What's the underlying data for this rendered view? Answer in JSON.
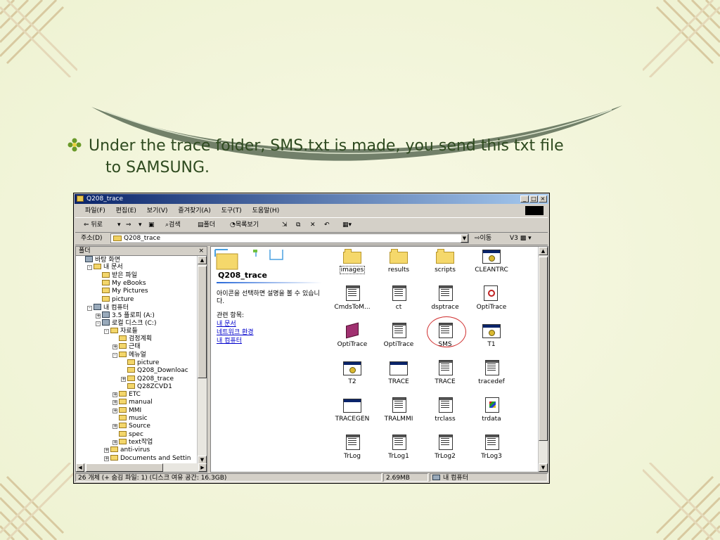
{
  "slide": {
    "bullet_text_line1": "Under the trace folder, SMS.txt is made, you send this txt file",
    "bullet_text_line2": "to SAMSUNG."
  },
  "window": {
    "title": "Q208_trace",
    "title_buttons": [
      "_",
      "□",
      "×"
    ],
    "menu": [
      "파일(F)",
      "편집(E)",
      "보기(V)",
      "즐겨찾기(A)",
      "도구(T)",
      "도움말(H)"
    ],
    "toolbar": {
      "back": "⇐ 뒤로",
      "forward": "⇒",
      "search": "검색",
      "folders": "폴더",
      "history": "목록보기"
    },
    "address": {
      "label": "주소(D)",
      "value": "Q208_trace",
      "go": "이동",
      "v3": "V3"
    }
  },
  "folder_pane": {
    "title": "폴더",
    "close": "×",
    "tree": [
      {
        "label": "바탕 화면",
        "indent": 0,
        "type": "pc",
        "expander": ""
      },
      {
        "label": "내 문서",
        "indent": 1,
        "type": "folder",
        "expander": "-"
      },
      {
        "label": "받은 파일",
        "indent": 2,
        "type": "folder",
        "expander": ""
      },
      {
        "label": "My eBooks",
        "indent": 2,
        "type": "folder",
        "expander": ""
      },
      {
        "label": "My Pictures",
        "indent": 2,
        "type": "folder",
        "expander": ""
      },
      {
        "label": "picture",
        "indent": 2,
        "type": "folder",
        "expander": ""
      },
      {
        "label": "내 컴퓨터",
        "indent": 1,
        "type": "pc",
        "expander": "-"
      },
      {
        "label": "3.5 플로피 (A:)",
        "indent": 2,
        "type": "pc",
        "expander": "+"
      },
      {
        "label": "로컬 디스크 (C:)",
        "indent": 2,
        "type": "pc",
        "expander": "-"
      },
      {
        "label": "자료들",
        "indent": 3,
        "type": "folder",
        "expander": "-"
      },
      {
        "label": "검정계획",
        "indent": 4,
        "type": "folder",
        "expander": ""
      },
      {
        "label": "근태",
        "indent": 4,
        "type": "folder",
        "expander": "+"
      },
      {
        "label": "메뉴얼",
        "indent": 4,
        "type": "folder",
        "expander": "-"
      },
      {
        "label": "picture",
        "indent": 5,
        "type": "folder",
        "expander": ""
      },
      {
        "label": "Q208_Downloac",
        "indent": 5,
        "type": "folder",
        "expander": ""
      },
      {
        "label": "Q208_trace",
        "indent": 5,
        "type": "folder",
        "expander": "+"
      },
      {
        "label": "Q28ZCVD1",
        "indent": 5,
        "type": "folder",
        "expander": ""
      },
      {
        "label": "ETC",
        "indent": 4,
        "type": "folder",
        "expander": "+"
      },
      {
        "label": "manual",
        "indent": 4,
        "type": "folder",
        "expander": "+"
      },
      {
        "label": "MMI",
        "indent": 4,
        "type": "folder",
        "expander": "+"
      },
      {
        "label": "music",
        "indent": 4,
        "type": "folder",
        "expander": ""
      },
      {
        "label": "Source",
        "indent": 4,
        "type": "folder",
        "expander": "+"
      },
      {
        "label": "spec",
        "indent": 4,
        "type": "folder",
        "expander": ""
      },
      {
        "label": "text작업",
        "indent": 4,
        "type": "folder",
        "expander": "+"
      },
      {
        "label": "anti-virus",
        "indent": 3,
        "type": "folder",
        "expander": "+"
      },
      {
        "label": "Documents and Settin",
        "indent": 3,
        "type": "folder",
        "expander": "+"
      }
    ]
  },
  "web_view": {
    "folder_title": "Q208_trace",
    "description": "아이콘을 선택하면 설명을 볼 수 있습니다.",
    "related_label": "관련 항목:",
    "links": [
      "내 문서",
      "네트워크 환경",
      "내 컴퓨터"
    ]
  },
  "files": [
    {
      "name": "images",
      "kind": "folder",
      "selected": true
    },
    {
      "name": "results",
      "kind": "folder"
    },
    {
      "name": "scripts",
      "kind": "folder"
    },
    {
      "name": "CLEANTRC",
      "kind": "exe"
    },
    {
      "name": "CmdsToM...",
      "kind": "txt"
    },
    {
      "name": "ct",
      "kind": "txt"
    },
    {
      "name": "dsptrace",
      "kind": "txt"
    },
    {
      "name": "OptiTrace",
      "kind": "mag"
    },
    {
      "name": "OptiTrace",
      "kind": "book"
    },
    {
      "name": "OptiTrace",
      "kind": "txt"
    },
    {
      "name": "SMS",
      "kind": "txt",
      "highlighted": true
    },
    {
      "name": "T1",
      "kind": "exe"
    },
    {
      "name": "T2",
      "kind": "exe"
    },
    {
      "name": "TRACE",
      "kind": "win"
    },
    {
      "name": "TRACE",
      "kind": "txt"
    },
    {
      "name": "tracedef",
      "kind": "txt"
    },
    {
      "name": "TRACEGEN",
      "kind": "win"
    },
    {
      "name": "TRALMMI",
      "kind": "txt"
    },
    {
      "name": "trclass",
      "kind": "txt"
    },
    {
      "name": "trdata",
      "kind": "wrt"
    },
    {
      "name": "TrLog",
      "kind": "txt"
    },
    {
      "name": "TrLog1",
      "kind": "txt"
    },
    {
      "name": "TrLog2",
      "kind": "txt"
    },
    {
      "name": "TrLog3",
      "kind": "txt"
    }
  ],
  "status_bar": {
    "count": "26 개체 (+ 숨김 파일: 1) (디스크 여유 공간: 16.3GB)",
    "size": "2.69MB",
    "location": "내 컴퓨터"
  },
  "colors": {
    "text_green": "#2e4a1f",
    "title_blue": "#0a246a",
    "highlight_red": "#d03030"
  }
}
